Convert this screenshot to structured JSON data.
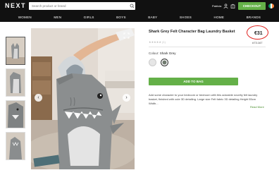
{
  "header": {
    "logo": "NEXT",
    "search_placeholder": "Search product or brand",
    "account_name": "Patricia",
    "bag_count": "0",
    "checkout_label": "CHECKOUT"
  },
  "nav": [
    "WOMEN",
    "MEN",
    "GIRLS",
    "BOYS",
    "BABY",
    "SHOES",
    "HOME",
    "BRANDS"
  ],
  "product": {
    "title": "Shark Grey Felt Character Bag Laundry Basket",
    "price": "€31",
    "rating_count": "(1)",
    "item_code": "#73.167",
    "colour_label": "Colour:",
    "colour_value": "Shark Grey",
    "add_to_bag": "ADD TO BAG",
    "description": "Add some character to your bedroom or bedroom with this adorable novelty felt laundry basket, finished with cute 3D detailing. Large size Felt fabric 3D detailing Height 55cm Width...",
    "read_more": "Read More"
  },
  "colors": {
    "accent_green": "#64b048",
    "header_bg": "#111111",
    "price_highlight": "#e0201c",
    "swatch_1": "#e6e6e6",
    "swatch_2": "#6f7a6e"
  },
  "icons": [
    "search-icon",
    "account-icon",
    "bag-icon",
    "flag-icon",
    "chevron-left-icon",
    "chevron-right-icon",
    "expand-icon"
  ]
}
